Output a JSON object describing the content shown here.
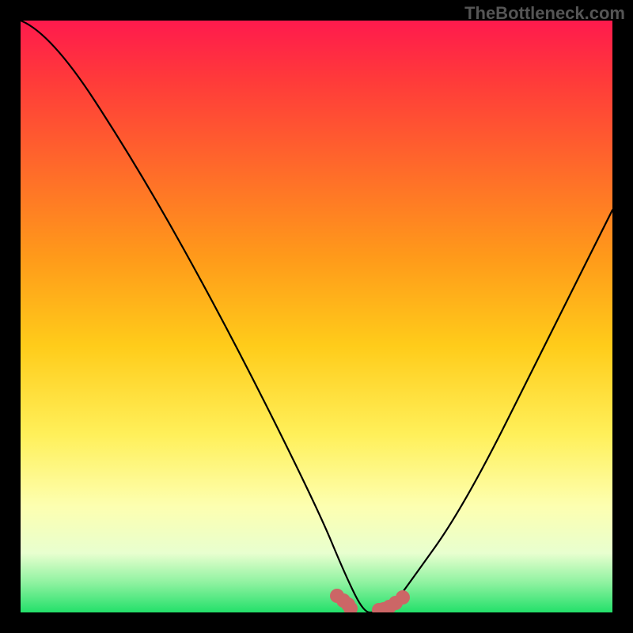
{
  "watermark": "TheBottleneck.com",
  "chart_data": {
    "type": "line",
    "title": "",
    "xlabel": "",
    "ylabel": "",
    "xlim": [
      0,
      100
    ],
    "ylim": [
      0,
      100
    ],
    "series": [
      {
        "name": "curve",
        "x": [
          0,
          5,
          20,
          35,
          50,
          55,
          58,
          60,
          62,
          65,
          75,
          90,
          100
        ],
        "y": [
          100,
          98,
          75,
          48,
          18,
          6,
          0,
          0,
          0,
          4,
          18,
          48,
          68
        ]
      }
    ],
    "annotations": {
      "marker_cluster_left": {
        "x": [
          53.5,
          54.5,
          55.3,
          55.8
        ],
        "y": [
          2.8,
          2.0,
          1.3,
          0.7
        ]
      },
      "marker_cluster_right": {
        "x": [
          60.5,
          61.3,
          62.3,
          63.4,
          64.6
        ],
        "y": [
          0.4,
          0.6,
          1.0,
          1.6,
          2.5
        ]
      }
    },
    "background_gradient": {
      "top": "#ff1a4d",
      "mid": "#ffe040",
      "bottom": "#23e06a"
    }
  }
}
